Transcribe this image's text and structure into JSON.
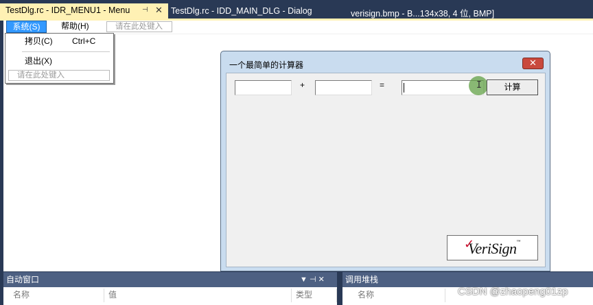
{
  "tabs": [
    {
      "label": "TestDlg.rc - IDR_MENU1 - Menu",
      "pin": "⊣",
      "close": "✕"
    },
    {
      "label": "TestDlg.rc - IDD_MAIN_DLG - Dialog"
    },
    {
      "label": "verisign.bmp - B...134x38, 4 位, BMP]"
    }
  ],
  "menu_editor": {
    "items": [
      "系统(S)",
      "帮助(H)"
    ],
    "type_here": "请在此处键入",
    "dropdown": {
      "items": [
        {
          "label": "拷贝(C)",
          "accelerator": "Ctrl+C"
        },
        {
          "label": "退出(X)",
          "accelerator": ""
        }
      ],
      "type_here": "请在此处键入"
    }
  },
  "dialog": {
    "title": "一个最简单的计算器",
    "close_glyph": "✕",
    "plus": "+",
    "equals": "=",
    "calc_button": "计算",
    "logo_text": "VeriSign",
    "logo_mark": "✓",
    "logo_tm": "™"
  },
  "panels": {
    "auto_window": {
      "title": "自动窗口",
      "controls": "▼  ⊣  ✕",
      "columns": [
        "名称",
        "值",
        "类型"
      ]
    },
    "call_stack": {
      "title": "调用堆栈",
      "columns": [
        "名称"
      ]
    }
  },
  "watermark": "CSDN @zhaopeng01zp",
  "colors": {
    "ide_background": "#293955",
    "active_tab": "#fff1b4",
    "menu_highlight": "#3399ff",
    "dialog_frame": "#c9dcef",
    "close_button": "#c9493d"
  }
}
